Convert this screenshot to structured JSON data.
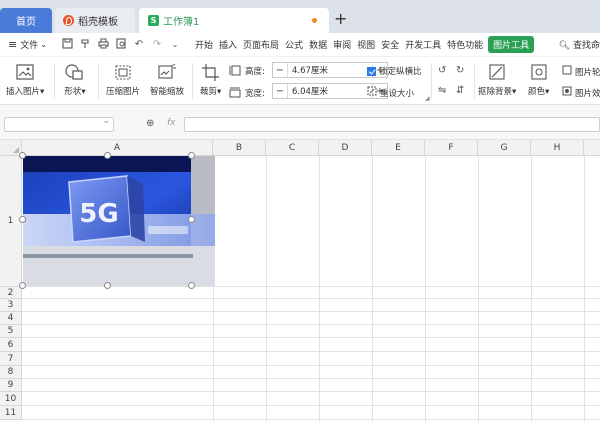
{
  "tabs": {
    "home": "首页",
    "template": "稻壳模板",
    "workbook": "工作簿1",
    "wb_icon_letter": "S",
    "add": "+"
  },
  "menu": {
    "file": "文件",
    "items": [
      "开始",
      "插入",
      "页面布局",
      "公式",
      "数据",
      "审阅",
      "视图",
      "安全",
      "开发工具",
      "特色功能",
      "图片工具"
    ],
    "search": "查找命"
  },
  "ribbon": {
    "insert_picture": "插入图片",
    "shape": "形状",
    "compress_picture": "压缩图片",
    "smart_zoom": "智能缩放",
    "crop": "裁剪",
    "height_label": "高度:",
    "height_value": "4.67厘米",
    "width_label": "宽度:",
    "width_value": "6.04厘米",
    "lock_ratio": "锁定纵横比",
    "reset_size": "重设大小",
    "remove_background": "抠除背景",
    "color": "颜色",
    "picture_a": "图片轮",
    "picture_b": "图片效"
  },
  "formula_bar": {
    "fx": "fx",
    "name_box_value": "",
    "formula_value": ""
  },
  "sheet": {
    "columns": [
      "A",
      "B",
      "C",
      "D",
      "E",
      "F",
      "G",
      "H"
    ],
    "rows": [
      "1",
      "2",
      "3",
      "4",
      "5",
      "6",
      "7",
      "8",
      "9",
      "10",
      "11"
    ]
  },
  "picture": {
    "caption": "5G"
  },
  "colors": {
    "accent_green": "#2ba055",
    "tab_blue": "#4a7bd8",
    "unsaved_orange": "#f08b23"
  }
}
